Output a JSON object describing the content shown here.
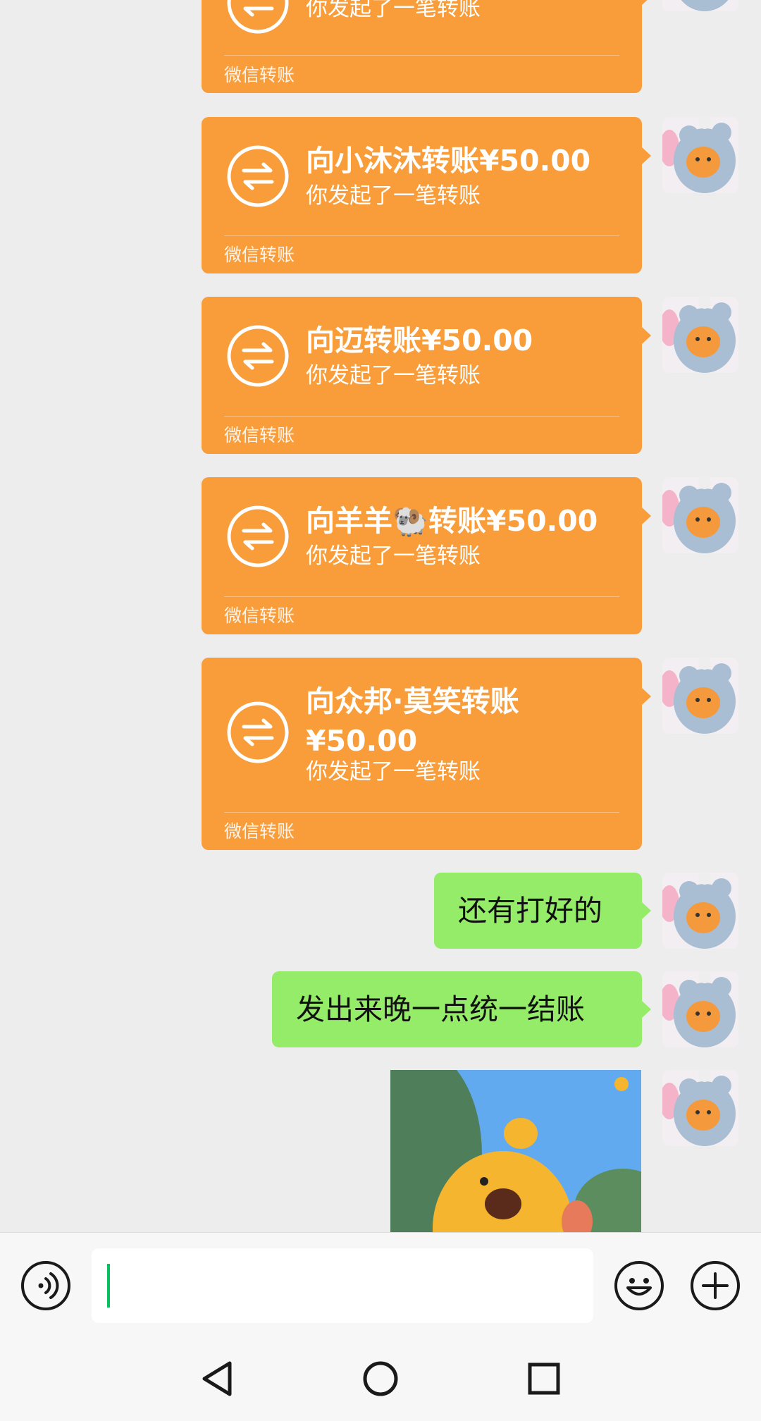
{
  "app": "WeChat",
  "chat": {
    "transfers": [
      {
        "title": "",
        "subtitle": "你发起了一笔转账",
        "footer": "微信转账"
      },
      {
        "title": "向小沐沐转账¥50.00",
        "subtitle": "你发起了一笔转账",
        "footer": "微信转账"
      },
      {
        "title": "向迈转账¥50.00",
        "subtitle": "你发起了一笔转账",
        "footer": "微信转账"
      },
      {
        "title": "向羊羊🐏转账¥50.00",
        "subtitle": "你发起了一笔转账",
        "footer": "微信转账"
      },
      {
        "title": "向众邦·莫笑转账¥50.00",
        "subtitle": "你发起了一笔转账",
        "footer": "微信转账"
      }
    ],
    "text_messages": [
      "还有打好的",
      "发出来晚一点统一结账"
    ],
    "sticker": "cartoon-duck-sticker"
  },
  "input_bar": {
    "voice_icon": "voice-icon",
    "text_value": "",
    "emoji_icon": "emoji-icon",
    "more_icon": "plus-icon",
    "accent_color": "#07c160"
  },
  "nav_bar": {
    "back_icon": "triangle-back-icon",
    "home_icon": "circle-home-icon",
    "recents_icon": "square-recents-icon"
  },
  "colors": {
    "transfer_bubble": "#f89d3a",
    "text_bubble": "#95ec69",
    "background": "#ededed"
  }
}
